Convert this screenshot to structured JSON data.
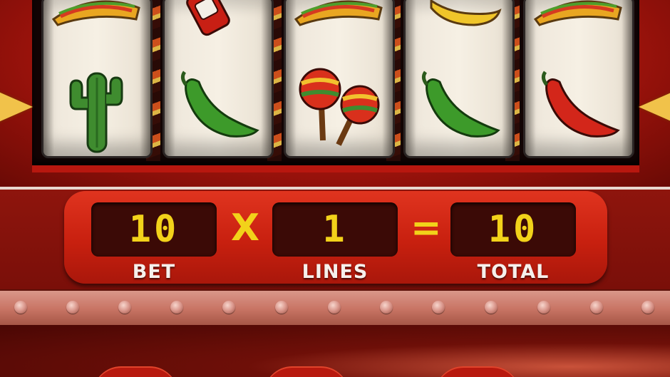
{
  "reels": [
    {
      "top_symbol": "taco",
      "middle_symbol": "cactus"
    },
    {
      "top_symbol": "hot-sauce-bottle",
      "middle_symbol": "green-chili-pepper"
    },
    {
      "top_symbol": "taco",
      "middle_symbol": "maracas"
    },
    {
      "top_symbol": "yellow-chili-pepper",
      "middle_symbol": "green-chili-pepper"
    },
    {
      "top_symbol": "taco",
      "middle_symbol": "red-chili-pepper"
    }
  ],
  "bet_panel": {
    "bet_value": "10",
    "multiply_sign": "X",
    "lines_value": "1",
    "equals_sign": "=",
    "total_value": "10",
    "bet_label": "BET",
    "lines_label": "LINES",
    "total_label": "TOTAL"
  },
  "colors": {
    "lcd_digits": "#f2d21a",
    "panel_red": "#c8200f",
    "payline_arrow": "#f1c24a"
  }
}
